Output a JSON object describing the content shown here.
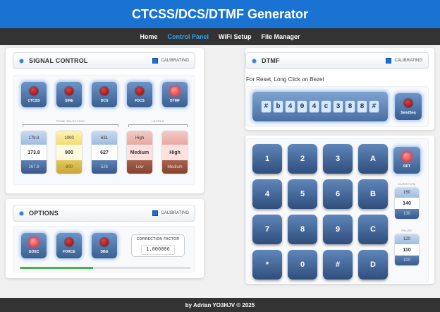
{
  "header": {
    "title": "CTCSS/DCS/DTMF Generator"
  },
  "nav": {
    "items": [
      "Home",
      "Control Panel",
      "WiFi Setup",
      "File Manager"
    ],
    "active_index": 1
  },
  "signal_control": {
    "title": "SIGNAL CONTROL",
    "status": "CALIBRATING",
    "toggles": [
      {
        "label": "CTCSS",
        "on": false
      },
      {
        "label": "SINE",
        "on": false
      },
      {
        "label": "DCS",
        "on": false
      },
      {
        "label": "FDCS",
        "on": false
      },
      {
        "label": "DTMF",
        "on": true
      }
    ],
    "tone_selection_label": "TONE SELECTION",
    "levels_label": "LEVELS",
    "spinners": [
      {
        "prev": "179.9",
        "value": "173.8",
        "next": "167.9"
      },
      {
        "prev": "1000",
        "value": "900",
        "next": "800"
      },
      {
        "prev": "631",
        "value": "627",
        "next": "526"
      },
      {
        "prev": "High",
        "value": "Medium",
        "next": "Low"
      },
      {
        "prev": "",
        "value": "High",
        "next": "Medium"
      }
    ]
  },
  "options": {
    "title": "OPTIONS",
    "status": "CALIBRATING",
    "toggles": [
      {
        "label": "GOSC",
        "on": true
      },
      {
        "label": "FORCE",
        "on": false
      },
      {
        "label": "DBG",
        "on": false
      }
    ],
    "correction_label": "CORRECTION FACTOR",
    "correction_value": "1.000006",
    "progress": 0.43,
    "progress_color": "#3bb44a"
  },
  "dtmf": {
    "title": "DTMF",
    "status": "CALIBRATING",
    "reset_note": "For Reset, Long Click on Bezel",
    "sequence": [
      "#",
      "b",
      "4",
      "0",
      "4",
      "c",
      "3",
      "8",
      "8",
      "#"
    ],
    "send_label": "SendSeq",
    "keys": [
      "1",
      "2",
      "3",
      "A",
      "4",
      "5",
      "6",
      "B",
      "7",
      "8",
      "9",
      "C",
      "*",
      "0",
      "#",
      "D"
    ],
    "rpt_label": "RPT",
    "duration_label": "DURATION",
    "duration": {
      "prev": "150",
      "value": "140",
      "next": "130"
    },
    "pause_label": "PAUSE",
    "pause": {
      "prev": "120",
      "value": "110",
      "next": "100"
    }
  },
  "footer": {
    "text": "by Adrian YO3HJV © 2025"
  },
  "colors": {
    "brand": "#1a73d2",
    "nav_bg": "#333333",
    "nav_active": "#39a0f0",
    "led_on": "#ff2a2a"
  }
}
